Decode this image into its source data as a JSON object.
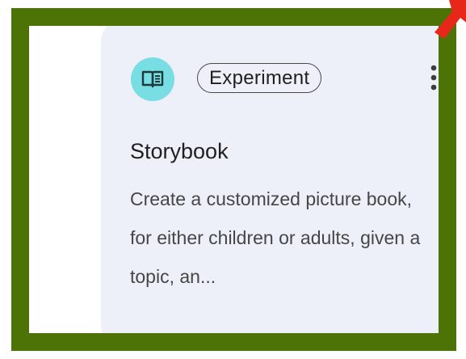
{
  "card": {
    "chip_label": "Experiment",
    "title": "Storybook",
    "description": "Create a customized picture book, for either children or adults, given a topic, an...",
    "icon": "book-icon",
    "menu_icon": "more-vert-icon"
  },
  "colors": {
    "frame": "#4d7205",
    "card_bg": "#eef0f9",
    "icon_bg": "#79dde4",
    "arrow": "#e8271b"
  }
}
